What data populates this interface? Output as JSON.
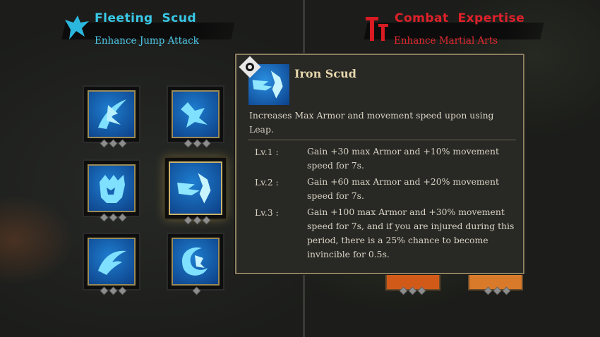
{
  "left_tree": {
    "title": "Fleeting  Scud",
    "subtitle": "Enhance Jump Attack",
    "emblem_icon": "blue-bird-emblem-icon",
    "accent_color": "#39c8e8"
  },
  "right_tree": {
    "title": "Combat  Expertise",
    "subtitle": "Enhance Martial Arts",
    "emblem_icon": "red-swords-emblem-icon",
    "accent_color": "#e0202a"
  },
  "skills": [
    {
      "icon": "slash-bird-icon",
      "level": 3
    },
    {
      "icon": "diving-bird-icon",
      "level": 3
    },
    {
      "icon": "beast-armor-icon",
      "level": 3
    },
    {
      "icon": "iron-scud-icon",
      "level": 3,
      "selected": true
    },
    {
      "icon": "wing-icon",
      "level": 3
    },
    {
      "icon": "spiral-bird-icon",
      "level": 1
    }
  ],
  "tooltip": {
    "name": "Iron Scud",
    "icon": "iron-scud-icon",
    "badge_icon": "ring-badge-icon",
    "description": "Increases Max Armor and movement speed upon using Leap.",
    "levels": [
      {
        "label": "Lv.1 :",
        "text": "Gain +30 max Armor and +10% movement speed for 7s."
      },
      {
        "label": "Lv.2 :",
        "text": "Gain +60 max Armor and +20% movement speed for 7s."
      },
      {
        "label": "Lv.3 :",
        "text": "Gain +100 max Armor and +30% movement speed for 7s, and if you are injured during this period, there is a 25% chance to become invincible for 0.5s."
      }
    ]
  }
}
